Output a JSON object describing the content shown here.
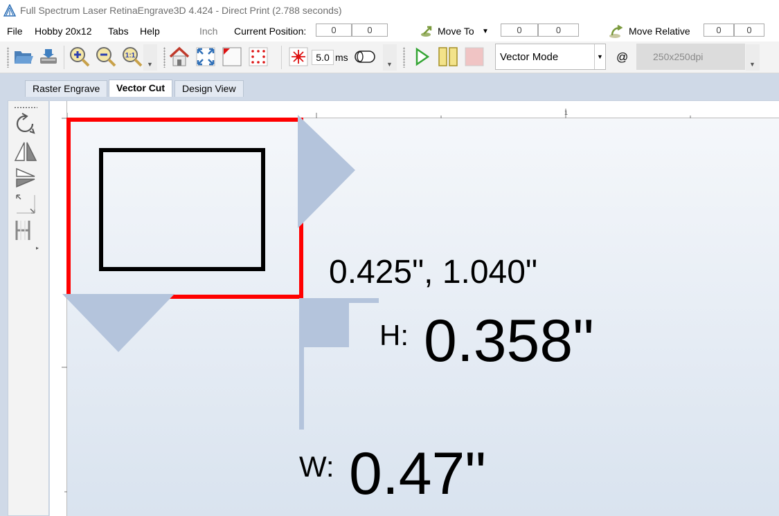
{
  "window": {
    "title": "Full Spectrum Laser RetinaEngrave3D 4.424 - Direct Print (2.788 seconds)"
  },
  "menu": {
    "items": [
      "File",
      "Hobby 20x12",
      "Tabs",
      "Help"
    ],
    "unit_label": "Inch",
    "current_position_label": "Current Position:",
    "current_position": [
      "0",
      "0"
    ],
    "move_to_label": "Move To",
    "move_to": [
      "0",
      "0"
    ],
    "move_relative_label": "Move Relative",
    "move_relative": [
      "0",
      "0"
    ]
  },
  "toolbar": {
    "laser_time_value": "5.0",
    "laser_time_unit": "ms",
    "mode_select": "Vector Mode",
    "at_symbol": "@",
    "dpi_value": "250x250dpi",
    "icons": [
      "open-file-icon",
      "save-icon",
      "zoom-in-icon",
      "zoom-out-icon",
      "zoom-actual-icon",
      "home-icon",
      "fit-icon",
      "corner-icon",
      "dot-grid-icon",
      "laser-icon",
      "air-assist-icon",
      "run-icon",
      "pause-icon",
      "stop-icon"
    ]
  },
  "tabs": [
    {
      "label": "Raster Engrave",
      "active": false
    },
    {
      "label": "Vector Cut",
      "active": true
    },
    {
      "label": "Design View",
      "active": false
    }
  ],
  "left_tools": [
    "rotate-icon",
    "flip-horizontal-icon",
    "flip-vertical-icon",
    "resize-icon",
    "align-icon"
  ],
  "ruler": {
    "top_label": "1"
  },
  "canvas": {
    "position_readout": "0.425\", 1.040\"",
    "height_label": "H:",
    "height_value": "0.358\"",
    "width_label": "W:",
    "width_value": "0.47\""
  },
  "colors": {
    "selection": "#ff0000",
    "handle": "#b4c4dc",
    "workspace": "#cfd9e7"
  }
}
